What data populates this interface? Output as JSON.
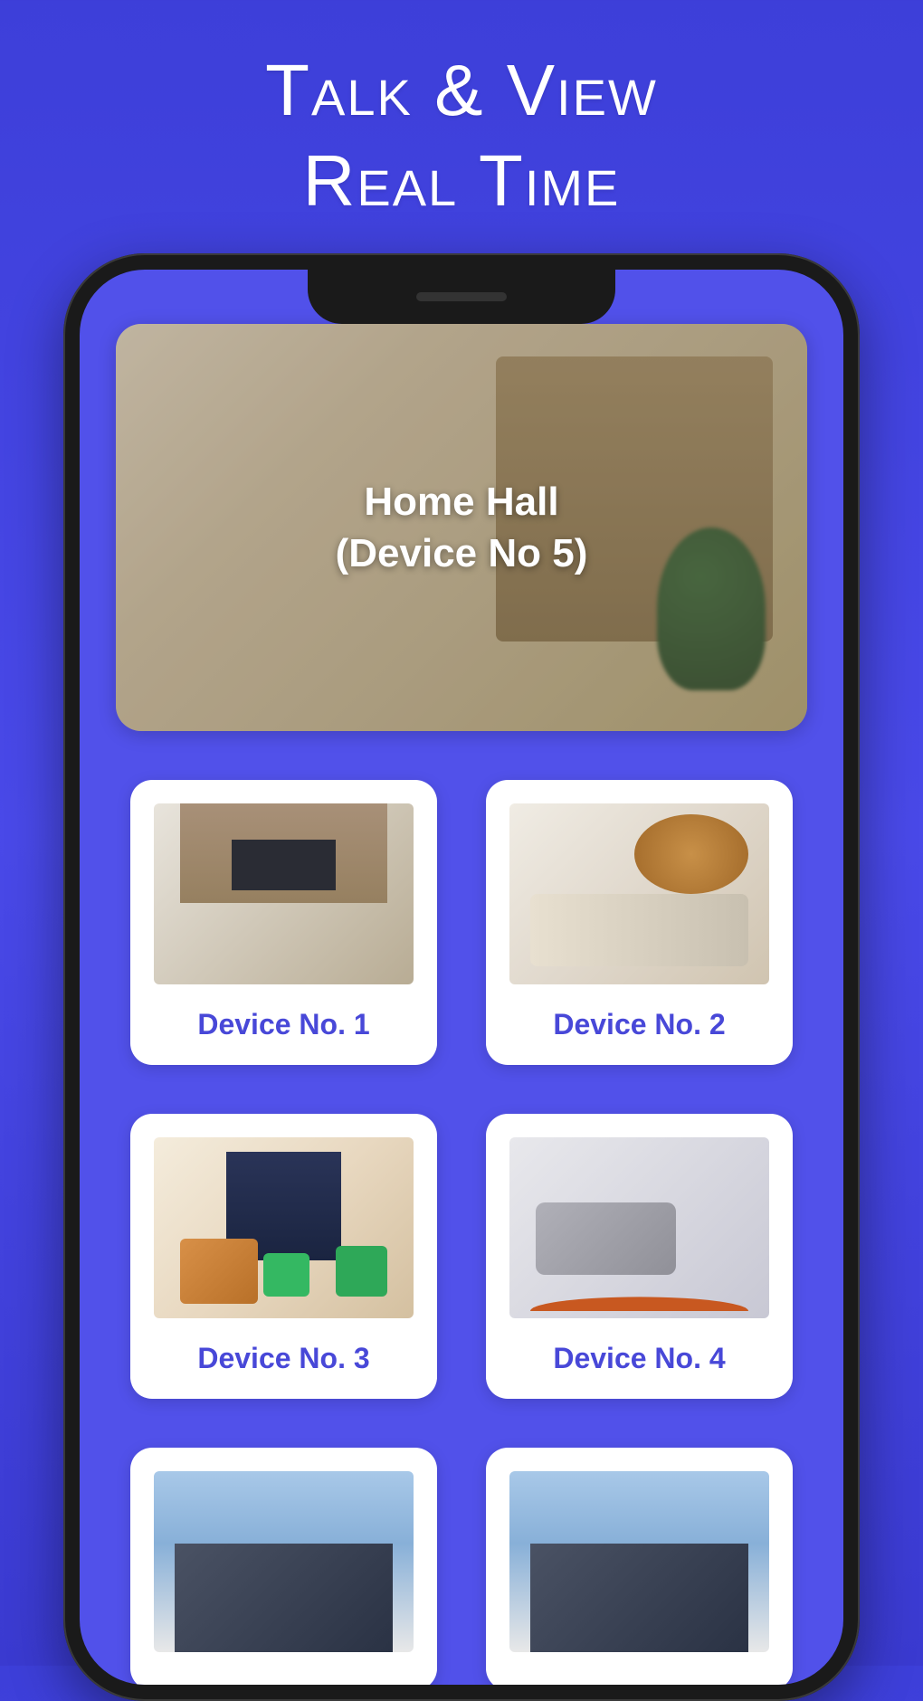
{
  "headline": {
    "line1": "Talk & View",
    "line2": "Real Time"
  },
  "main_camera": {
    "title": "Home Hall",
    "subtitle": "(Device No 5)"
  },
  "devices": [
    {
      "label": "Device No. 1"
    },
    {
      "label": "Device No. 2"
    },
    {
      "label": "Device No. 3"
    },
    {
      "label": "Device No. 4"
    }
  ],
  "colors": {
    "accent": "#4848d8",
    "background": "#3d3fd9"
  }
}
